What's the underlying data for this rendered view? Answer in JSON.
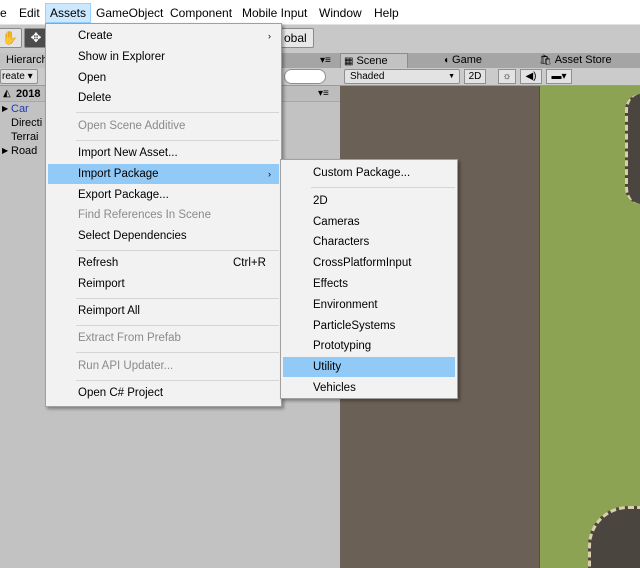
{
  "menubar": {
    "items": [
      {
        "label": "e"
      },
      {
        "label": "Edit"
      },
      {
        "label": "Assets"
      },
      {
        "label": "GameObject"
      },
      {
        "label": "Component"
      },
      {
        "label": "Mobile Input"
      },
      {
        "label": "Window"
      },
      {
        "label": "Help"
      }
    ]
  },
  "toolbar": {
    "global_label": "obal",
    "hand_icon": "✋",
    "move_icon": "✥"
  },
  "hierarchy": {
    "tab_label": "Hierarch",
    "create_label": "reate ▾",
    "menu_dots": "▾≡",
    "scene_name": "2018",
    "scene_icon": "◭",
    "scene_menu": "▾≡",
    "items": [
      {
        "label": "Car",
        "arrow": "▶"
      },
      {
        "label": "Directi",
        "arrow": ""
      },
      {
        "label": "Terrai",
        "arrow": ""
      },
      {
        "label": "Road",
        "arrow": "▶"
      }
    ]
  },
  "scene_panel": {
    "tabs": [
      {
        "label": "Scene",
        "icon": "▦"
      },
      {
        "label": "Game",
        "icon": "◖"
      },
      {
        "label": "Asset Store",
        "icon": "🛍"
      }
    ],
    "shading_mode": "Shaded",
    "mode_2d": "2D",
    "light_icon": "☼",
    "audio_icon": "◀)",
    "image_icon": "▬▾",
    "menu_dots": "▾≡"
  },
  "assets_menu": {
    "items": [
      {
        "label": "Create",
        "submenu": true
      },
      {
        "label": "Show in Explorer"
      },
      {
        "label": "Open"
      },
      {
        "label": "Delete"
      },
      {
        "label": "Open Scene Additive",
        "disabled": true
      },
      {
        "label": "Import New Asset..."
      },
      {
        "label": "Import Package",
        "submenu": true,
        "highlighted": true
      },
      {
        "label": "Export Package..."
      },
      {
        "label": "Find References In Scene",
        "disabled": true
      },
      {
        "label": "Select Dependencies"
      },
      {
        "label": "Refresh",
        "shortcut": "Ctrl+R"
      },
      {
        "label": "Reimport"
      },
      {
        "label": "Reimport All"
      },
      {
        "label": "Extract From Prefab",
        "disabled": true
      },
      {
        "label": "Run API Updater...",
        "disabled": true
      },
      {
        "label": "Open C# Project"
      }
    ],
    "submenu_arrow": "›"
  },
  "import_package_submenu": {
    "items": [
      {
        "label": "Custom Package..."
      },
      {
        "label": "2D"
      },
      {
        "label": "Cameras"
      },
      {
        "label": "Characters"
      },
      {
        "label": "CrossPlatformInput"
      },
      {
        "label": "Effects"
      },
      {
        "label": "Environment"
      },
      {
        "label": "ParticleSystems"
      },
      {
        "label": "Prototyping"
      },
      {
        "label": "Utility",
        "highlighted": true
      },
      {
        "label": "Vehicles"
      }
    ]
  }
}
